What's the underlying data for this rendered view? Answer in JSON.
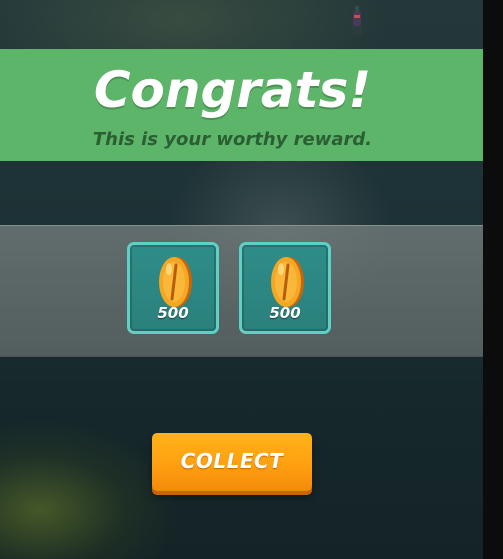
{
  "header": {
    "title": "Congrats!",
    "subtitle": "This is your worthy reward."
  },
  "rewards": [
    {
      "icon": "gold-coin-icon",
      "amount": "500"
    },
    {
      "icon": "gold-coin-icon",
      "amount": "500"
    }
  ],
  "actions": {
    "collect_label": "COLLECT"
  },
  "colors": {
    "banner": "#5cb569",
    "title_text": "#ffffff",
    "subtitle_text": "#2b5e33",
    "tile_border": "#5fd0c4",
    "tile_fill": "#2e8d88",
    "button": "#ffa010",
    "coin": "#f5a623"
  }
}
